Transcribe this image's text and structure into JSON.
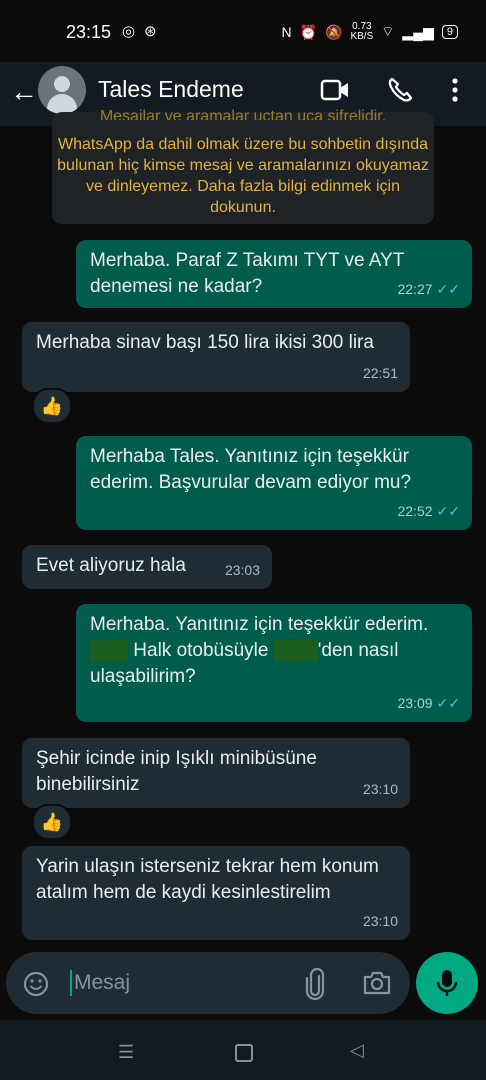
{
  "status_bar": {
    "time": "23:15",
    "net_speed": "0.73",
    "net_unit": "KB/S",
    "battery": "9"
  },
  "header": {
    "contact_name": "Tales Endeme"
  },
  "notice": {
    "hidden_line": "Mesajlar ve aramalar uçtan uca şifrelidir.",
    "text": "WhatsApp da dahil olmak üzere bu sohbetin dışında bulunan hiç kimse mesaj ve aramalarınızı okuyamaz ve dinleyemez. Daha fazla bilgi edinmek için dokunun."
  },
  "messages": [
    {
      "text": "Merhaba. Paraf Z Takımı TYT ve AYT denemesi ne kadar?",
      "time": "22:27"
    },
    {
      "text": "Merhaba sinav başı 150 lira ikisi 300 lira",
      "time": "22:51",
      "reaction": "👍"
    },
    {
      "text": "Merhaba Tales. Yanıtınız için teşekkür ederim. Başvurular devam ediyor mu?",
      "time": "22:52"
    },
    {
      "text": "Evet aliyoruz hala",
      "time": "23:03"
    },
    {
      "text_line1": "Merhaba. Yanıtınız için teşekkür ederim.",
      "text_part_a": " Halk otobüsüyle ",
      "text_part_b": "'den nasıl ulaşabilirim?",
      "time": "23:09"
    },
    {
      "text": "Şehir icinde inip Işıklı minibüsüne binebilirsiniz",
      "time": "23:10",
      "reaction": "👍"
    },
    {
      "text": "Yarin ulaşın isterseniz tekrar hem konum atalım hem de kaydi kesinlestirelim",
      "time": "23:10"
    }
  ],
  "input": {
    "placeholder": "Mesaj"
  },
  "colors": {
    "outgoing_bubble": "#005c4b",
    "incoming_bubble": "#1f2c33",
    "accent": "#00a884",
    "read_ticks": "#53bdeb"
  }
}
